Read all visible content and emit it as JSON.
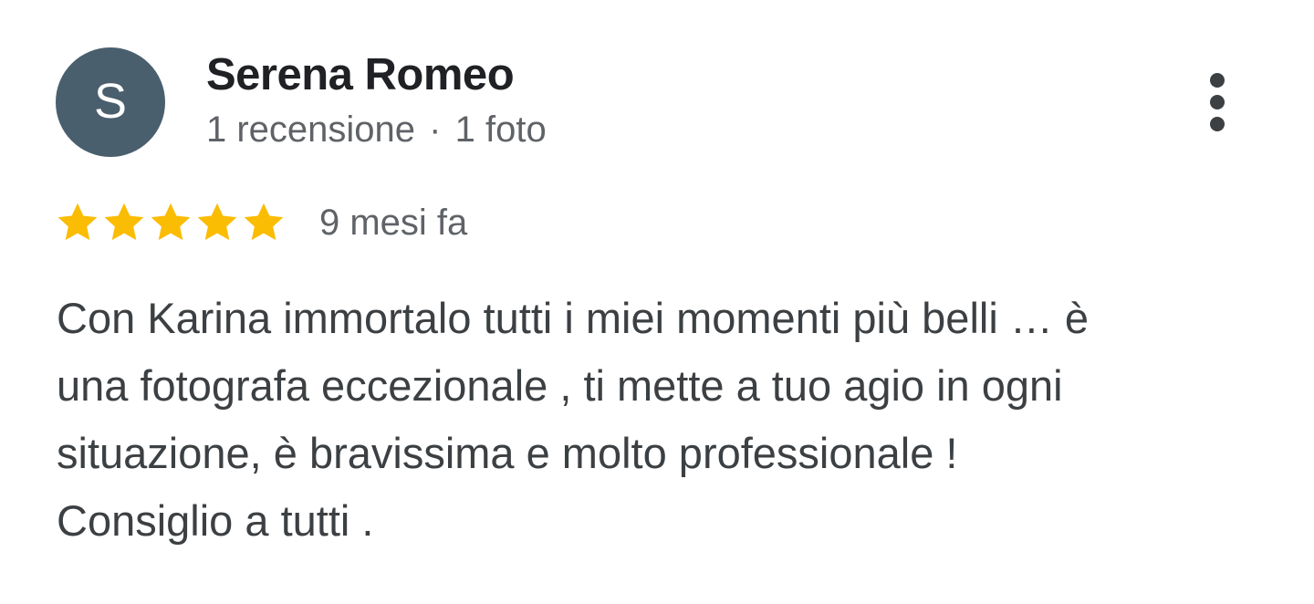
{
  "review": {
    "author": {
      "initial": "S",
      "name": "Serena Romeo",
      "review_count": "1 recensione",
      "separator": "·",
      "photo_count": "1 foto"
    },
    "more_options_icon": "more-vert-icon",
    "rating": {
      "stars": 5,
      "max": 5,
      "star_icon": "star-icon"
    },
    "date": "9 mesi fa",
    "text_lines": [
      "Con Karina immortalo tutti i miei momenti più belli … è",
      "una fotografa eccezionale , ti mette a tuo agio in ogni",
      "situazione, è bravissima e molto professionale !",
      "Consiglio a tutti ."
    ]
  },
  "colors": {
    "avatar_bg": "#4a5f6e",
    "star": "#fbbc04",
    "name_text": "#202124",
    "meta_text": "#5f6368",
    "body_text": "#3c4043"
  }
}
